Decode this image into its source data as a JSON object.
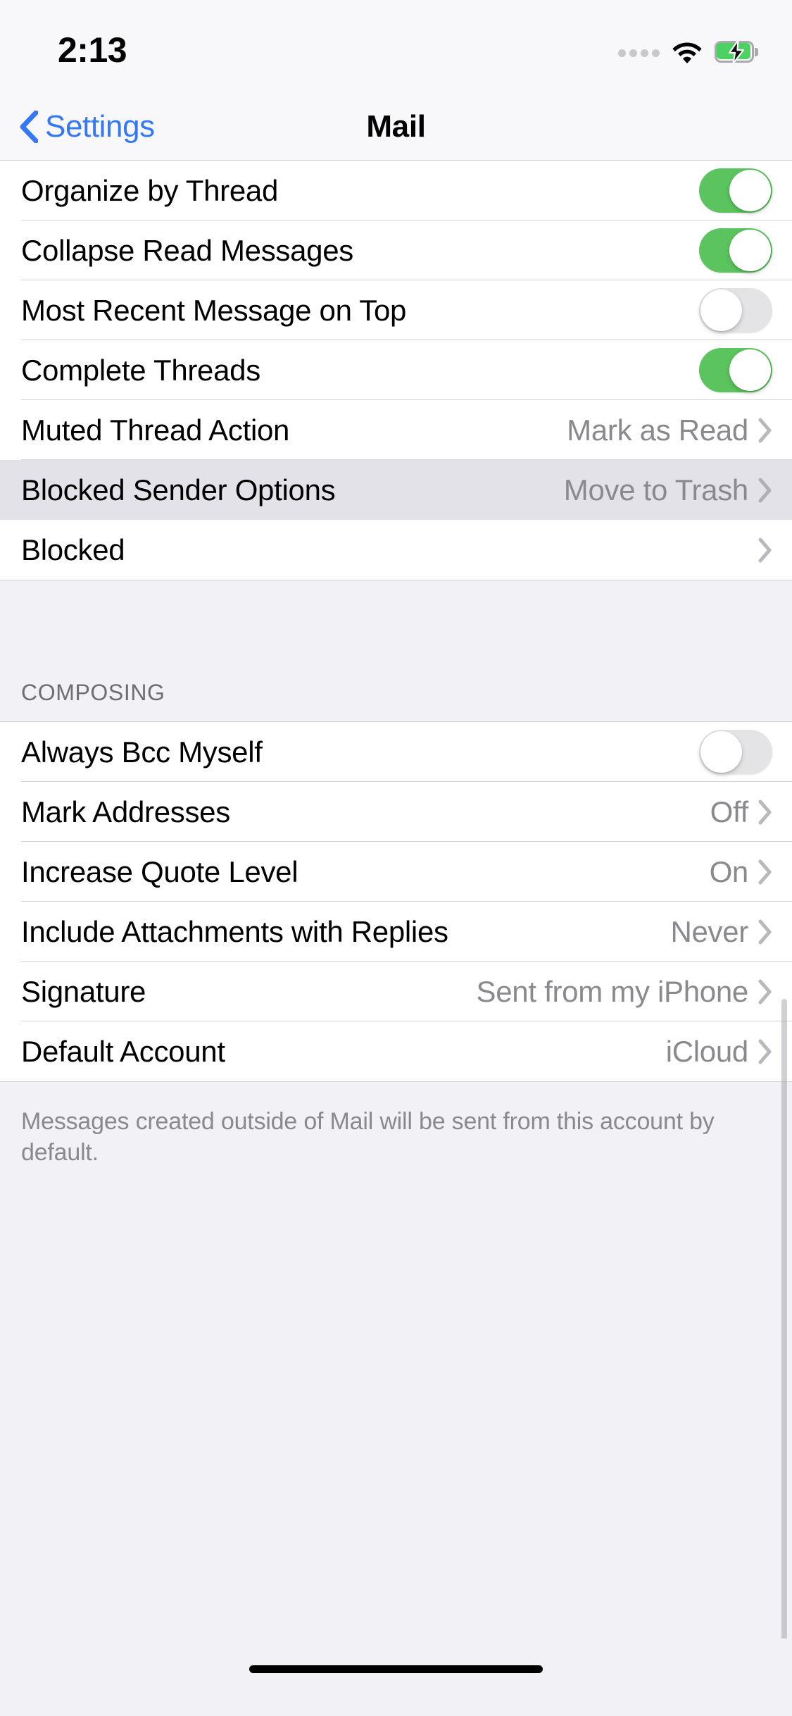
{
  "status_bar": {
    "time": "2:13",
    "signal_icon": "signal-dots-icon",
    "signal_dots": 4,
    "wifi_icon": "wifi-icon",
    "battery_icon": "battery-charging-icon",
    "battery_color": "#4CD263"
  },
  "nav": {
    "back_label": "Settings",
    "back_icon": "chevron-left-icon",
    "title": "Mail",
    "accent_color": "#3478F6"
  },
  "sections": [
    {
      "header": "",
      "footer": "",
      "rows": [
        {
          "label": "Organize by Thread",
          "type": "toggle",
          "value": "on"
        },
        {
          "label": "Collapse Read Messages",
          "type": "toggle",
          "value": "on"
        },
        {
          "label": "Most Recent Message on Top",
          "type": "toggle",
          "value": "off"
        },
        {
          "label": "Complete Threads",
          "type": "toggle",
          "value": "on"
        },
        {
          "label": "Muted Thread Action",
          "type": "disclosure",
          "value": "Mark as Read",
          "selected": false
        },
        {
          "label": "Blocked Sender Options",
          "type": "disclosure",
          "value": "Move to Trash",
          "selected": true
        },
        {
          "label": "Blocked",
          "type": "disclosure",
          "value": "",
          "selected": false
        }
      ]
    },
    {
      "header": "COMPOSING",
      "footer": "Messages created outside of Mail will be sent from this account by default.",
      "rows": [
        {
          "label": "Always Bcc Myself",
          "type": "toggle",
          "value": "off"
        },
        {
          "label": "Mark Addresses",
          "type": "disclosure",
          "value": "Off",
          "selected": false
        },
        {
          "label": "Increase Quote Level",
          "type": "disclosure",
          "value": "On",
          "selected": false
        },
        {
          "label": "Include Attachments with Replies",
          "type": "disclosure",
          "value": "Never",
          "selected": false
        },
        {
          "label": "Signature",
          "type": "disclosure",
          "value": "Sent from my iPhone",
          "selected": false
        },
        {
          "label": "Default Account",
          "type": "disclosure",
          "value": "iCloud",
          "selected": false
        }
      ]
    }
  ],
  "colors": {
    "toggle_on": "#5BC45E",
    "toggle_off": "#E4E4E6",
    "row_selected": "#E3E2E8",
    "group_background": "#F2F1F6",
    "value_text": "#8A8A8E"
  },
  "home_indicator": "home-indicator"
}
